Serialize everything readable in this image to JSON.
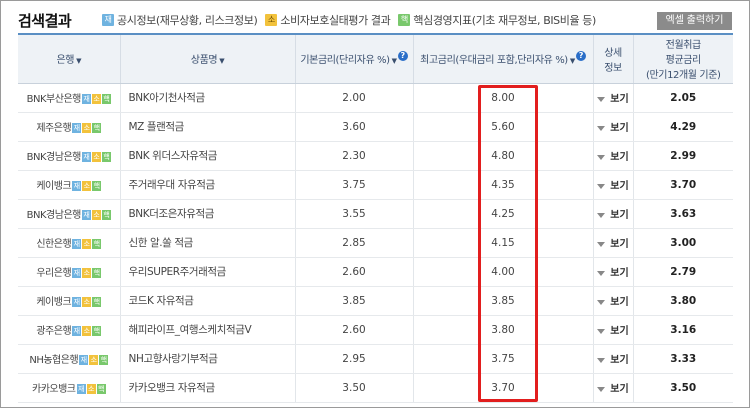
{
  "header": {
    "title": "검색결과",
    "legend": [
      {
        "badge": "재",
        "label": "공시정보(재무상황, 리스크정보)",
        "color": "#6fb3e0"
      },
      {
        "badge": "소",
        "label": "소비자보호실태평가 결과",
        "color": "#f2c23c"
      },
      {
        "badge": "핵",
        "label": "핵심경영지표(기초 재무정보, BIS비율 등)",
        "color": "#79c86c"
      }
    ],
    "excel_button": "엑셀 출력하기"
  },
  "columns": {
    "bank": "은행",
    "product": "상품명",
    "base_rate": "기본금리(단리자유 %)",
    "max_rate": "최고금리(우대금리 포함,단리자유 %)",
    "detail": "상세정보",
    "detail_line1": "상세",
    "detail_line2": "정보",
    "avg_line1": "전월취급",
    "avg_line2": "평균금리",
    "avg_line3": "(만기12개월 기준)"
  },
  "rows": [
    {
      "bank": "BNK부산은행",
      "product": "BNK아기천사적금",
      "base": "2.00",
      "max": "8.00",
      "detail": "보기",
      "avg": "2.05"
    },
    {
      "bank": "제주은행",
      "product": "MZ 플랜적금",
      "base": "3.60",
      "max": "5.60",
      "detail": "보기",
      "avg": "4.29"
    },
    {
      "bank": "BNK경남은행",
      "product": "BNK 위더스자유적금",
      "base": "2.30",
      "max": "4.80",
      "detail": "보기",
      "avg": "2.99"
    },
    {
      "bank": "케이뱅크",
      "product": "주거래우대 자유적금",
      "base": "3.75",
      "max": "4.35",
      "detail": "보기",
      "avg": "3.70"
    },
    {
      "bank": "BNK경남은행",
      "product": "BNK더조은자유적금",
      "base": "3.55",
      "max": "4.25",
      "detail": "보기",
      "avg": "3.63"
    },
    {
      "bank": "신한은행",
      "product": "신한 알.쏠 적금",
      "base": "2.85",
      "max": "4.15",
      "detail": "보기",
      "avg": "3.00"
    },
    {
      "bank": "우리은행",
      "product": "우리SUPER주거래적금",
      "base": "2.60",
      "max": "4.00",
      "detail": "보기",
      "avg": "2.79"
    },
    {
      "bank": "케이뱅크",
      "product": "코드K 자유적금",
      "base": "3.85",
      "max": "3.85",
      "detail": "보기",
      "avg": "3.80"
    },
    {
      "bank": "광주은행",
      "product": "해피라이프_여행스케치적금V",
      "base": "2.60",
      "max": "3.80",
      "detail": "보기",
      "avg": "3.16"
    },
    {
      "bank": "NH농협은행",
      "product": "NH고향사랑기부적금",
      "base": "2.95",
      "max": "3.75",
      "detail": "보기",
      "avg": "3.33"
    },
    {
      "bank": "카카오뱅크",
      "product": "카카오뱅크 자유적금",
      "base": "3.50",
      "max": "3.70",
      "detail": "보기",
      "avg": "3.50"
    }
  ]
}
